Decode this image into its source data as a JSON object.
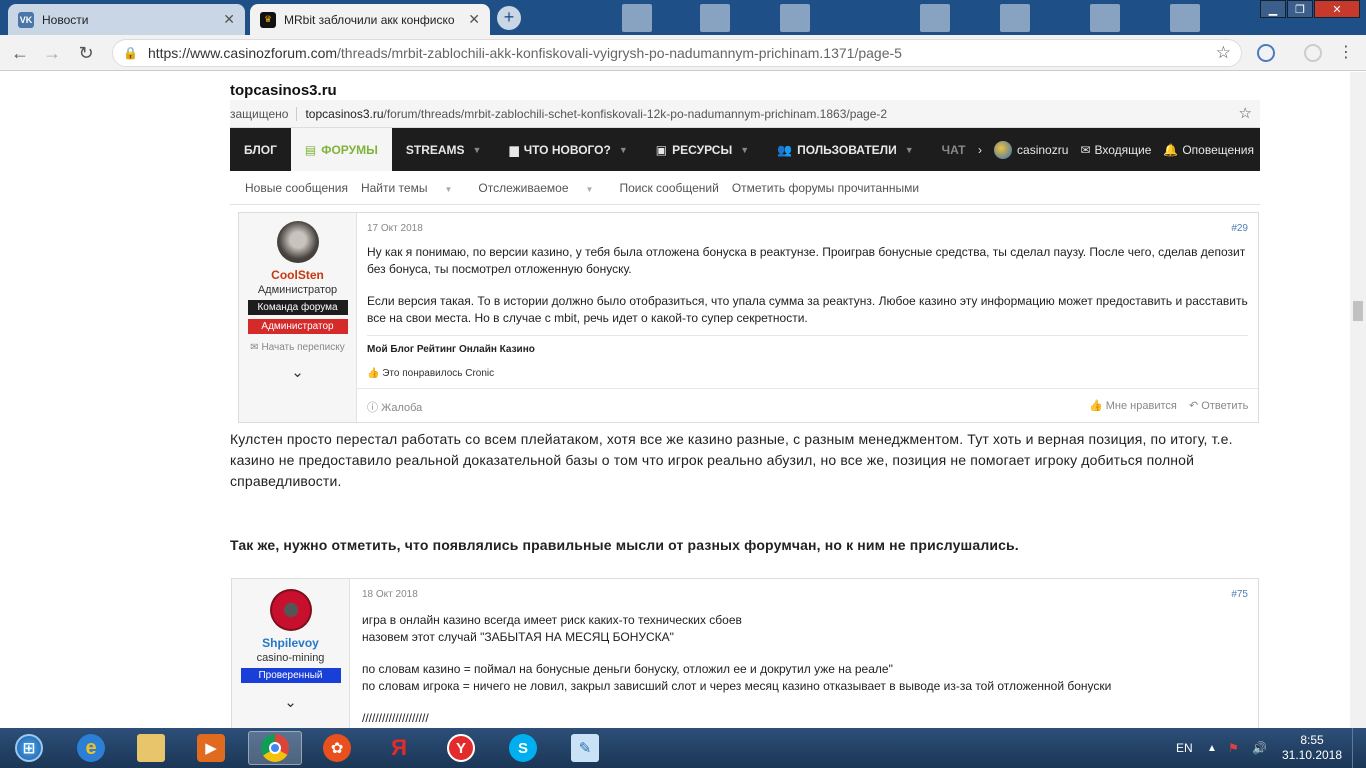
{
  "browser": {
    "tabs": [
      {
        "title": "Новости",
        "favicon": "vk-icon",
        "active": false
      },
      {
        "title": "MRbit заблочили акк конфиско",
        "favicon": "crown-icon",
        "active": true
      }
    ],
    "url_host": "https://www.casinozforum.com",
    "url_path": "/threads/mrbit-zablochili-akk-konfiskovali-vyigrysh-po-nadumannym-prichinam.1371/page-5"
  },
  "page": {
    "site_title": "topcasinos3.ru",
    "shot_url": {
      "protection": "защищено",
      "host": "topcasinos3.ru",
      "path": "/forum/threads/mrbit-zablochili-schet-konfiskovali-12k-po-nadumannym-prichinam.1863/page-2"
    },
    "forum_nav": {
      "blog": "БЛОГ",
      "forums": "ФОРУМЫ",
      "streams": "STREAMS",
      "whats_new": "ЧТО НОВОГО?",
      "resources": "РЕСУРСЫ",
      "users": "ПОЛЬЗОВАТЕЛИ",
      "chat": "ЧАТ",
      "account": "casinozru",
      "inbox": "Входящие",
      "alerts": "Оповещения"
    },
    "sub_nav": [
      "Новые сообщения",
      "Найти темы",
      "Отслеживаемое",
      "Поиск сообщений",
      "Отметить форумы прочитанными"
    ],
    "post1": {
      "username": "CoolSten",
      "user_title": "Администратор",
      "badge1": "Команда форума",
      "badge2": "Администратор",
      "start_conv": "Начать переписку",
      "date": "17 Окт 2018",
      "number": "#29",
      "p1": "Ну как я понимаю, по версии казино, у тебя была отложена бонуска в реактунзе. Проиграв бонусные средства, ты сделал паузу. После чего, сделав депозит без бонуса, ты посмотрел отложенную бонуску.",
      "p2": "Если версия такая. То в истории должно было отобразиться, что упала сумма за реактунз. Любое казино эту информацию может предоставить и расставить все на свои места. Но в случае с mbit, речь идет о какой-то супер секретности.",
      "signature": "Мой Блог Рейтинг Онлайн Казино",
      "likes": "Это понравилось Cronic",
      "report": "Жалоба",
      "like": "Мне нравится",
      "reply": "Ответить"
    },
    "article_p1": "Кулстен просто перестал работать со всем плейатаком, хотя все же казино разные, с разным менеджментом. Тут хоть и верная позиция, по итогу, т.е. казино не предоставило реальной доказательной базы о том что игрок реально абузил, но все же, позиция не помогает игроку добиться полной справедливости.",
    "article_p2": "Так же, нужно отметить, что появлялись правильные мысли от разных форумчан, но к ним не прислушались.",
    "post2": {
      "username": "Shpilevoy",
      "user_title": "casino-mining",
      "badge": "Проверенный",
      "date": "18 Окт 2018",
      "number": "#75",
      "l1": "игра в онлайн казино всегда имеет риск каких-то технических сбоев",
      "l2": "назовем этот случай \"ЗАБЫТАЯ НА МЕСЯЦ БОНУСКА\"",
      "l3": "по словам казино = поймал на бонусные деньги бонуску, отложил ее и докрутил уже на реале\"",
      "l4": "по словам игрока = ничего не ловил, закрыл зависший слот и через месяц казино отказывает в выводе из-за той отложенной бонуски",
      "l5": "////////////////////"
    }
  },
  "taskbar": {
    "lang": "EN",
    "time": "8:55",
    "date": "31.10.2018"
  },
  "colors": {
    "tab_bar": "#1f4f87",
    "forum_green": "#7fb33a",
    "admin_red": "#d42a2a",
    "verified_blue": "#1a3fd8",
    "username_red": "#c8380e",
    "username_blue": "#2577c7"
  }
}
